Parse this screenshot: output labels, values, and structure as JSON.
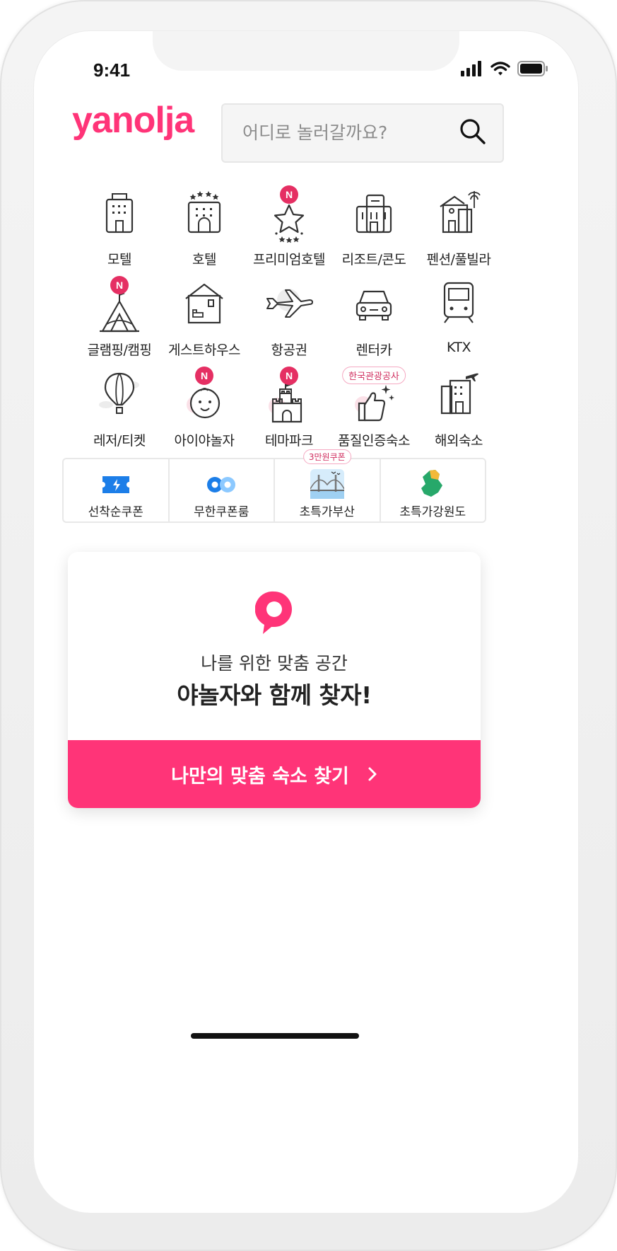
{
  "status": {
    "time": "9:41"
  },
  "brand": {
    "logo": "yanolja",
    "accent": "#ff3478"
  },
  "search": {
    "placeholder": "어디로 놀러갈까요?"
  },
  "categories": [
    {
      "label": "모텔",
      "icon": "motel-icon"
    },
    {
      "label": "호텔",
      "icon": "hotel-icon"
    },
    {
      "label": "프리미엄호텔",
      "icon": "star-icon",
      "badge": "N"
    },
    {
      "label": "리조트/콘도",
      "icon": "resort-icon"
    },
    {
      "label": "펜션/풀빌라",
      "icon": "pension-icon"
    },
    {
      "label": "글램핑/캠핑",
      "icon": "tent-icon",
      "badge": "N"
    },
    {
      "label": "게스트하우스",
      "icon": "guesthouse-icon"
    },
    {
      "label": "항공권",
      "icon": "airplane-icon"
    },
    {
      "label": "렌터카",
      "icon": "car-icon"
    },
    {
      "label": "KTX",
      "icon": "train-icon"
    },
    {
      "label": "레저/티켓",
      "icon": "balloon-icon"
    },
    {
      "label": "아이야놀자",
      "icon": "baby-icon",
      "badge": "N"
    },
    {
      "label": "테마파크",
      "icon": "castle-icon",
      "badge": "N"
    },
    {
      "label": "품질인증숙소",
      "icon": "thumbs-up-icon",
      "tag": "한국관광공사"
    },
    {
      "label": "해외숙소",
      "icon": "overseas-hotel-icon"
    }
  ],
  "coupons": [
    {
      "label": "선착순쿠폰",
      "icon": "ticket-icon"
    },
    {
      "label": "무한쿠폰룸",
      "icon": "infinity-icon"
    },
    {
      "label": "초특가부산",
      "icon": "busan-bridge-icon",
      "tag": "3만원쿠폰"
    },
    {
      "label": "초특가강원도",
      "icon": "gangwon-map-icon"
    }
  ],
  "promo": {
    "subtitle": "나를 위한 맞춤 공간",
    "title": "야놀자와 함께 찾자!",
    "button": "나만의 맞춤 숙소 찾기"
  }
}
